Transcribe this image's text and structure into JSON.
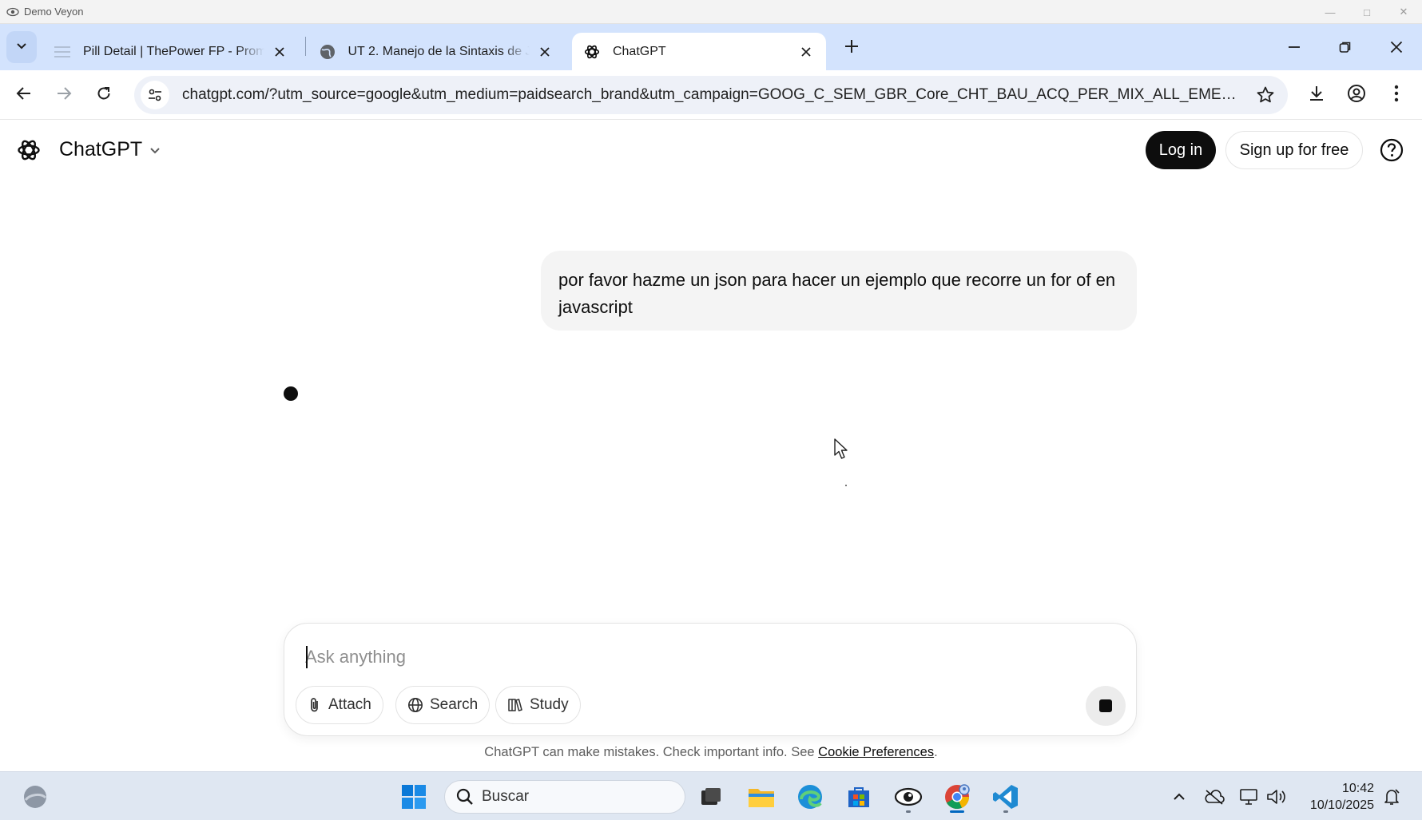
{
  "outer_window": {
    "title": "Demo Veyon"
  },
  "browser": {
    "tabs": [
      {
        "title": "Pill Detail | ThePower FP - Prom",
        "active": false
      },
      {
        "title": "UT 2. Manejo de la Sintaxis de J",
        "active": false
      },
      {
        "title": "ChatGPT",
        "active": true
      }
    ],
    "url": "chatgpt.com/?utm_source=google&utm_medium=paidsearch_brand&utm_campaign=GOOG_C_SEM_GBR_Core_CHT_BAU_ACQ_PER_MIX_ALL_EMEA_ES_..."
  },
  "chatgpt": {
    "model_label": "ChatGPT",
    "login_label": "Log in",
    "signup_label": "Sign up for free",
    "user_message": "por favor hazme un json para hacer un ejemplo que recorre un for of en javascript",
    "composer": {
      "placeholder": "Ask anything",
      "value": "",
      "attach_label": "Attach",
      "search_label": "Search",
      "study_label": "Study"
    },
    "footer": {
      "text": "ChatGPT can make mistakes. Check important info. See ",
      "link": "Cookie Preferences",
      "suffix": "."
    }
  },
  "taskbar": {
    "search_placeholder": "Buscar",
    "time": "10:42",
    "date": "10/10/2025"
  },
  "colors": {
    "tabstrip_bg": "#d3e3fd",
    "omnibox_bg": "#eef1f8",
    "primary_button": "#0d0d0d",
    "user_bubble": "#f4f4f4",
    "taskbar_bg": "#dfe7f2"
  },
  "icons": [
    "veyon-eye-icon",
    "tab-list-icon",
    "page-icon",
    "globe-icon",
    "chatgpt-logo-icon",
    "close-icon",
    "plus-icon",
    "minimize-icon",
    "restore-icon",
    "back-icon",
    "forward-icon",
    "reload-icon",
    "site-info-icon",
    "star-icon",
    "download-icon",
    "profile-icon",
    "more-icon",
    "chevron-down-icon",
    "help-icon",
    "paperclip-icon",
    "globe-icon",
    "book-icon",
    "stop-icon",
    "windows-start-icon",
    "search-icon"
  ]
}
